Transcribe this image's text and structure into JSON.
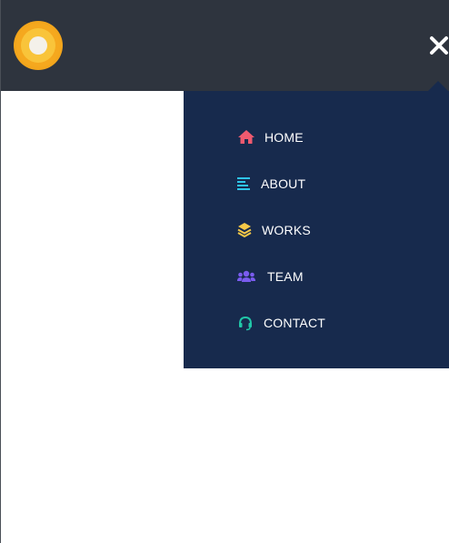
{
  "header": {
    "logo_name": "ring-logo",
    "close_icon": "close-icon"
  },
  "menu": {
    "items": [
      {
        "label": "HOME",
        "icon": "home-icon",
        "color": "#ef5a6f"
      },
      {
        "label": "ABOUT",
        "icon": "align-left-icon",
        "color": "#2ec4e8"
      },
      {
        "label": "WORKS",
        "icon": "layers-icon",
        "color": "#f7c948"
      },
      {
        "label": "TEAM",
        "icon": "users-icon",
        "color": "#7a5cf0"
      },
      {
        "label": "CONTACT",
        "icon": "headset-icon",
        "color": "#21c7a8"
      }
    ]
  },
  "colors": {
    "header_bg": "#2e343e",
    "menu_bg": "#172a4d",
    "logo_orange": "#f5a81e"
  }
}
